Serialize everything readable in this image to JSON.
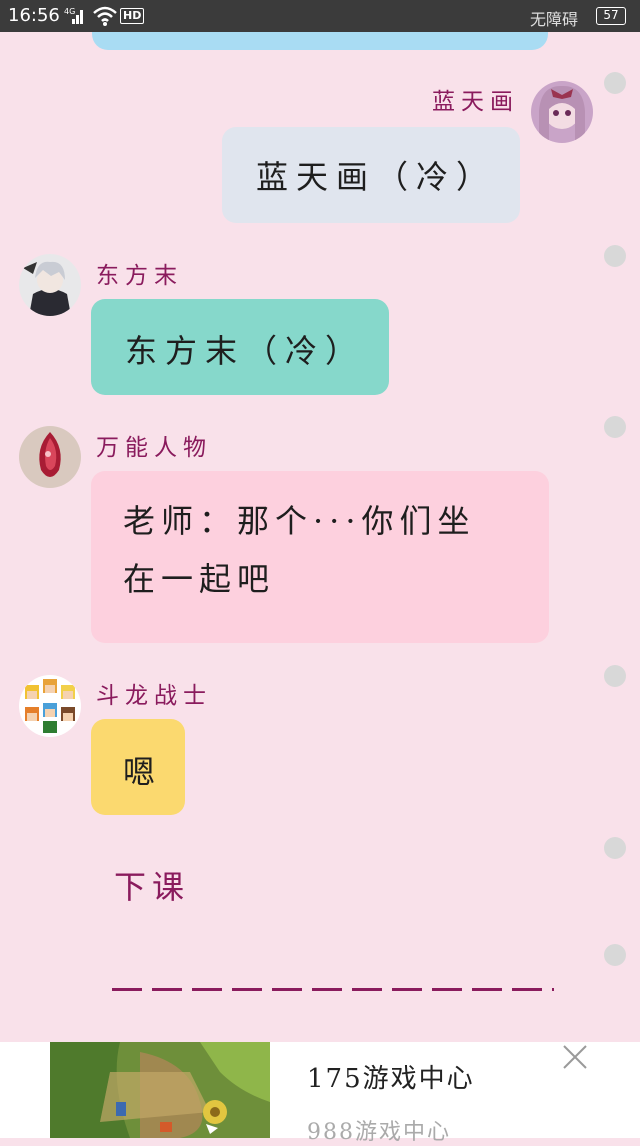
{
  "status_bar": {
    "time": "16:56",
    "network": "4G",
    "hd": "HD",
    "carrier_text": "无障碍",
    "battery": "57"
  },
  "messages": [
    {
      "sender": "蓝天画",
      "text": "蓝天画（冷）",
      "side": "right",
      "bubble_color": "#e0e5ee"
    },
    {
      "sender": "东方末",
      "text": "东方末（冷）",
      "side": "left",
      "bubble_color": "#86d8cb"
    },
    {
      "sender": "万能人物",
      "lines": [
        "老师：那个···你们坐",
        "在一起吧"
      ],
      "side": "left",
      "bubble_color": "#fdd0de"
    },
    {
      "sender": "斗龙战士",
      "text": "嗯",
      "side": "left",
      "bubble_color": "#fbd96f"
    }
  ],
  "narration": {
    "text": "下课",
    "divider": "——————————————"
  },
  "ad": {
    "title": "175游戏中心",
    "subtitle": "988游戏中心"
  },
  "colors": {
    "background": "#f9e1ea",
    "name_color": "#8a1b5d",
    "status_bar": "#3b3b3b"
  }
}
